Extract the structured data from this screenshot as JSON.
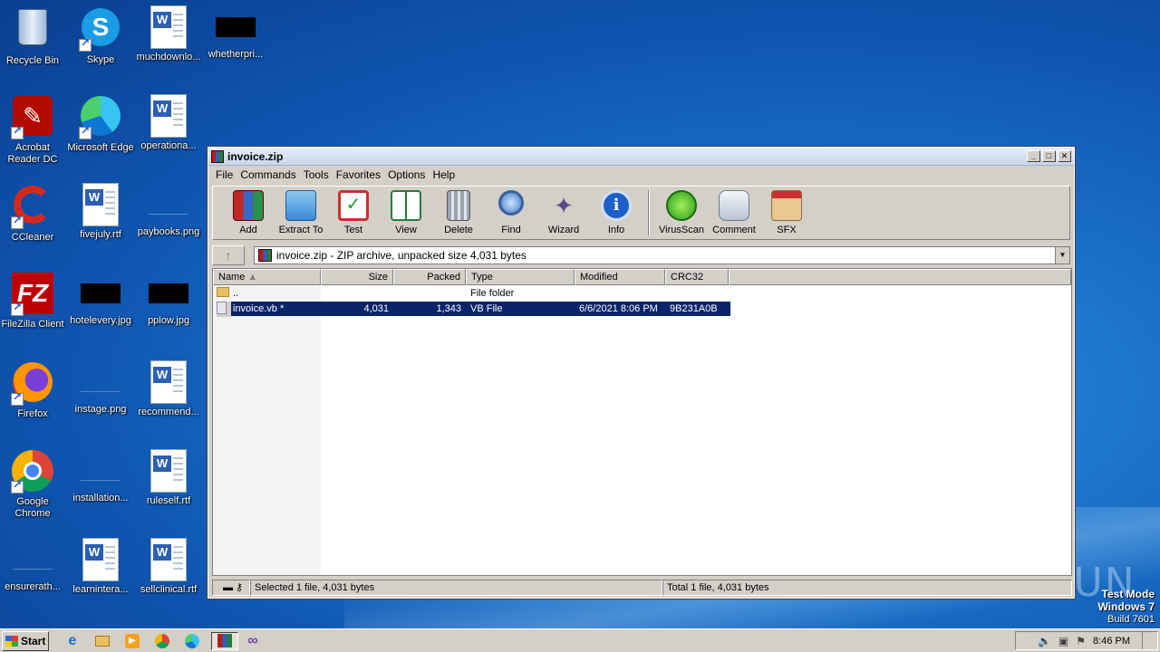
{
  "desktop": {
    "icons": [
      {
        "label": "Recycle Bin"
      },
      {
        "label": "Skype"
      },
      {
        "label": "muchdownlo..."
      },
      {
        "label": "whetherpri..."
      },
      {
        "label": "Acrobat Reader DC"
      },
      {
        "label": "Microsoft Edge"
      },
      {
        "label": "operationa..."
      },
      {
        "label": "CCleaner"
      },
      {
        "label": "fivejuly.rtf"
      },
      {
        "label": "paybooks.png"
      },
      {
        "label": "FileZilla Client"
      },
      {
        "label": "hotelevery.jpg"
      },
      {
        "label": "pplow.jpg"
      },
      {
        "label": "Firefox"
      },
      {
        "label": "instage.png"
      },
      {
        "label": "recommend..."
      },
      {
        "label": "Google Chrome"
      },
      {
        "label": "installation..."
      },
      {
        "label": "ruleself.rtf"
      },
      {
        "label": "ensurerath..."
      },
      {
        "label": "learninterа..."
      },
      {
        "label": "sellclinical.rtf"
      }
    ]
  },
  "window": {
    "title": "invoice.zip",
    "menu": [
      "File",
      "Commands",
      "Tools",
      "Favorites",
      "Options",
      "Help"
    ],
    "toolbar": [
      "Add",
      "Extract To",
      "Test",
      "View",
      "Delete",
      "Find",
      "Wizard",
      "Info",
      "VirusScan",
      "Comment",
      "SFX"
    ],
    "address": "invoice.zip - ZIP archive, unpacked size 4,031 bytes",
    "columns": [
      "Name",
      "Size",
      "Packed",
      "Type",
      "Modified",
      "CRC32"
    ],
    "rows": [
      {
        "name": "..",
        "size": "",
        "packed": "",
        "type": "File folder",
        "modified": "",
        "crc": ""
      },
      {
        "name": "invoice.vb *",
        "size": "4,031",
        "packed": "1,343",
        "type": "VB File",
        "modified": "6/6/2021 8:06 PM",
        "crc": "9B231A0B"
      }
    ],
    "status_left": "Selected 1 file, 4,031 bytes",
    "status_right": "Total 1 file, 4,031 bytes"
  },
  "taskbar": {
    "start_label": "Start",
    "clock": "8:46 PM"
  },
  "watermark": {
    "line1": "Test Mode",
    "line2": "Windows 7",
    "line3": "Build 7601",
    "brand": "ANY RUN"
  }
}
